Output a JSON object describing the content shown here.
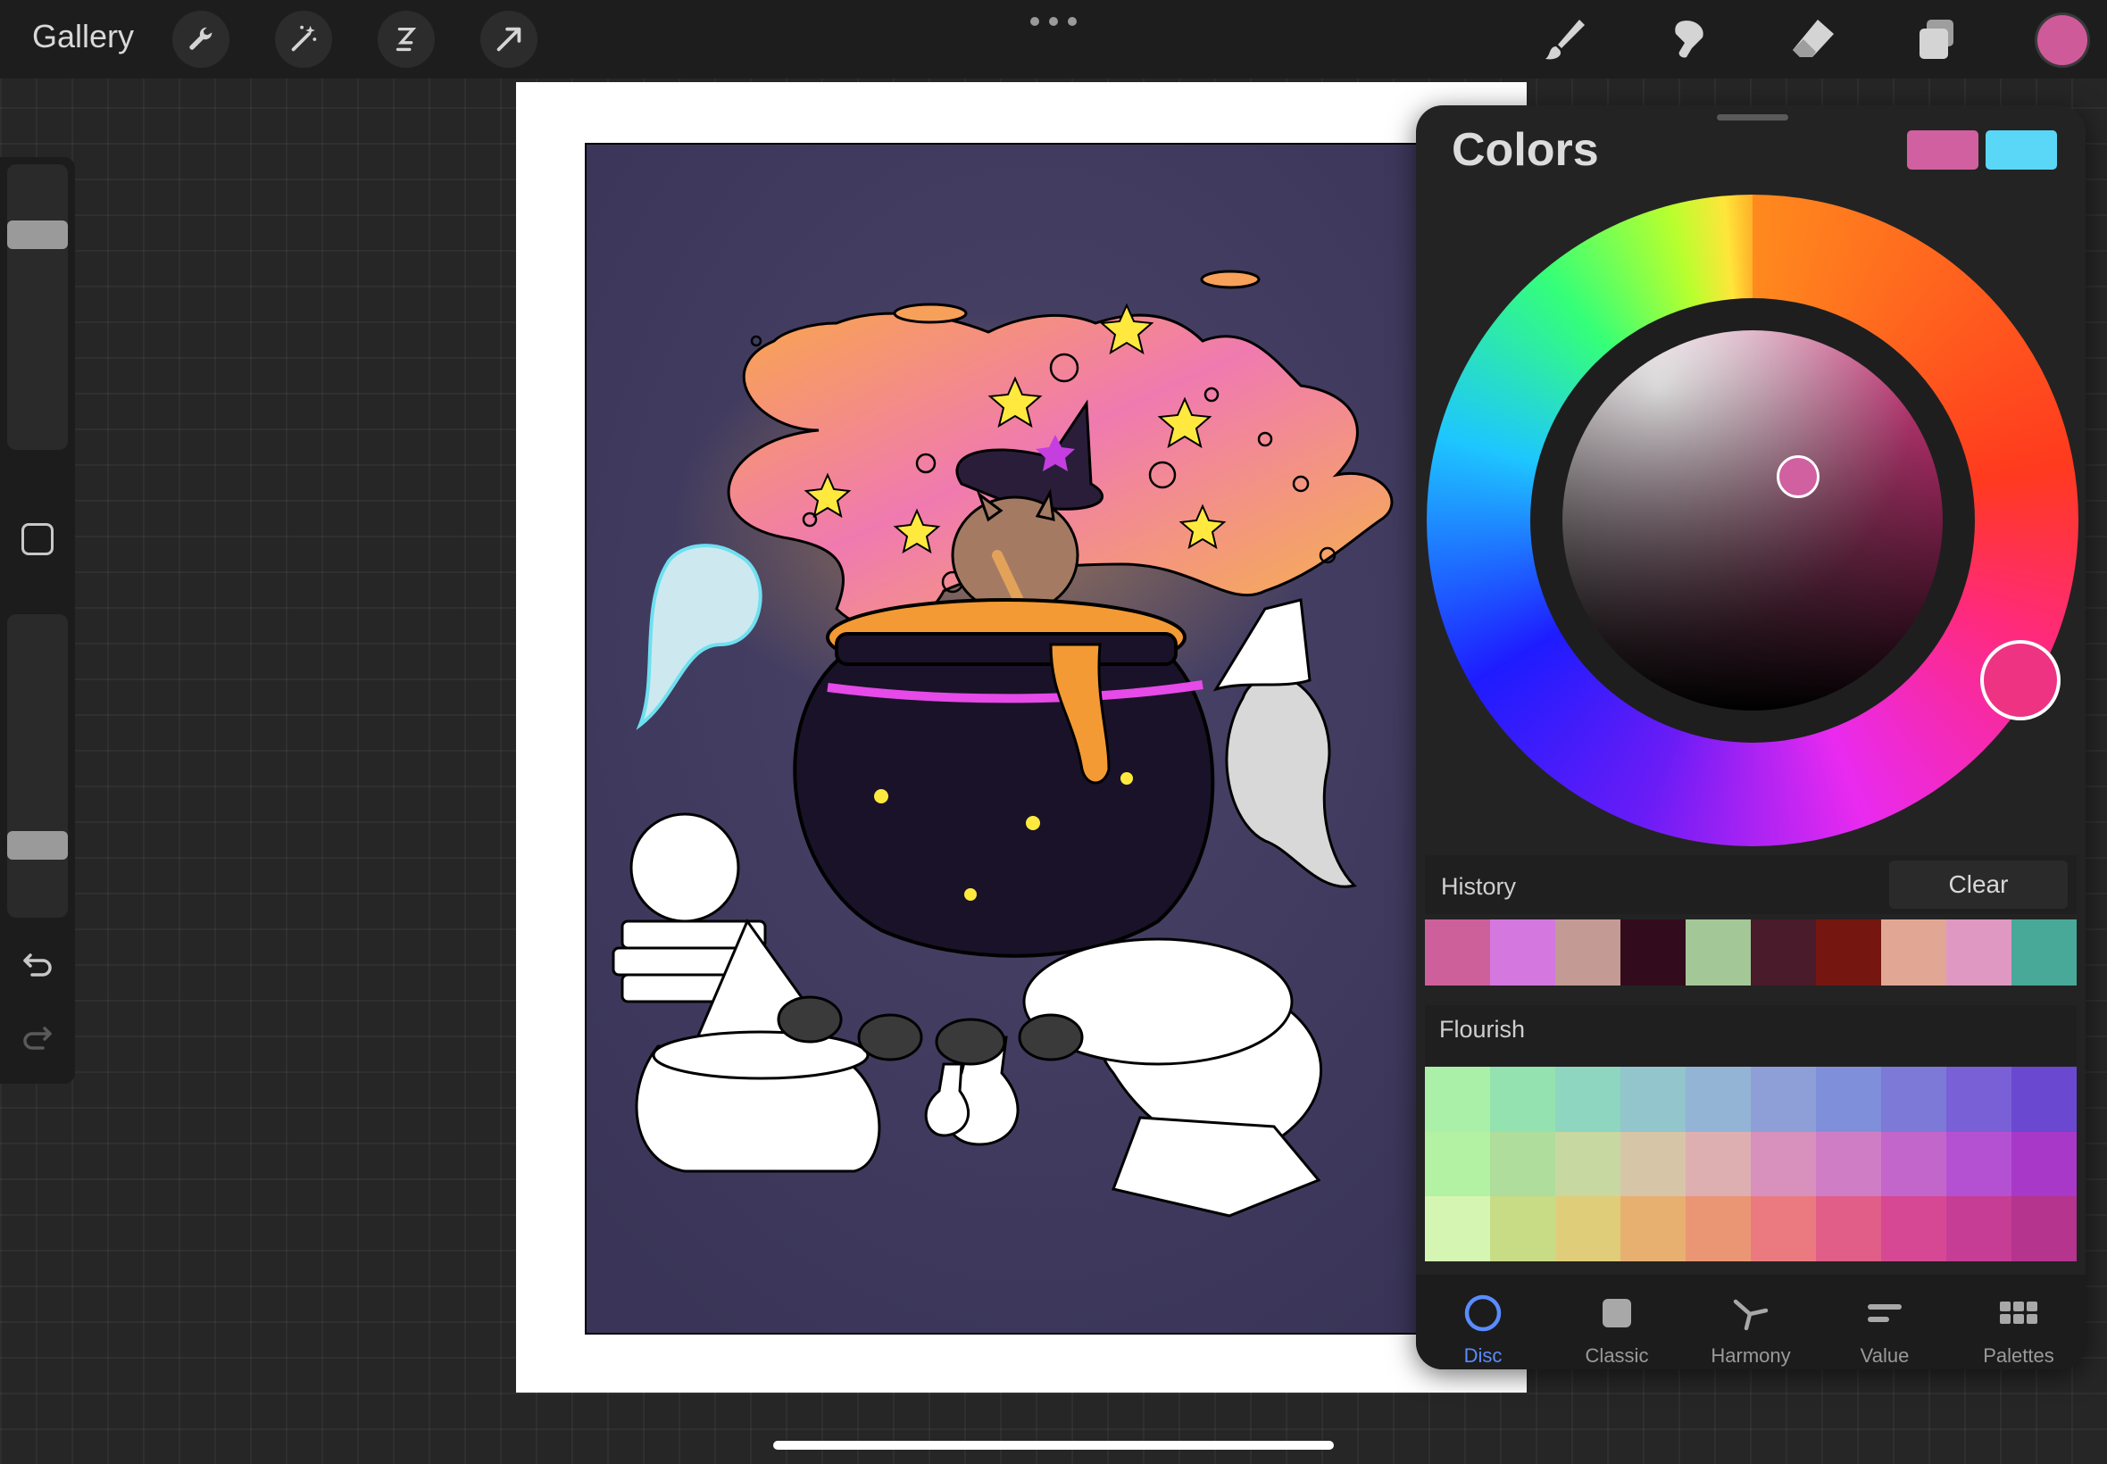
{
  "topbar": {
    "gallery_label": "Gallery",
    "tools": [
      "wrench-icon",
      "magic-wand-icon",
      "selection-icon",
      "transform-icon"
    ],
    "right_tools": [
      "brush-icon",
      "smudge-icon",
      "eraser-icon",
      "layers-icon"
    ],
    "current_color": "#cf5a9a"
  },
  "sidebar": {
    "size_slider_level": 0.78,
    "opacity_slider_level": 0.21,
    "icons": [
      "modify-square-icon",
      "undo-icon",
      "redo-icon"
    ]
  },
  "colors_panel": {
    "title": "Colors",
    "primary_color": "#d0609f",
    "secondary_color": "#5ad6f6",
    "history": {
      "label": "History",
      "clear_label": "Clear",
      "swatches": [
        "#cd5f9b",
        "#d477df",
        "#c49a95",
        "#320c1c",
        "#a4c797",
        "#4a1b2b",
        "#751610",
        "#e2a695",
        "#df98c1",
        "#48a999"
      ]
    },
    "flourish": {
      "label": "Flourish",
      "swatches": [
        "#aaf0a9",
        "#94e2af",
        "#8ed6c0",
        "#92c5cc",
        "#93b4d5",
        "#8e9fd7",
        "#7f8fda",
        "#7d79d6",
        "#7960d7",
        "#6b48d0",
        "#b3f2a2",
        "#aedd9c",
        "#c8d8a1",
        "#d7c5a8",
        "#deafb1",
        "#d891bc",
        "#cf7ec6",
        "#c266cc",
        "#b451d2",
        "#a838c8",
        "#d5f6b3",
        "#c7dc85",
        "#e0cd7a",
        "#e8b070",
        "#ea9674",
        "#ea7a7f",
        "#e05e88",
        "#d64893",
        "#c63d95",
        "#b4348e"
      ]
    },
    "tabs": [
      {
        "label": "Disc",
        "icon": "disc-icon",
        "active": true
      },
      {
        "label": "Classic",
        "icon": "classic-square-icon",
        "active": false
      },
      {
        "label": "Harmony",
        "icon": "harmony-icon",
        "active": false
      },
      {
        "label": "Value",
        "icon": "value-sliders-icon",
        "active": false
      },
      {
        "label": "Palettes",
        "icon": "palettes-grid-icon",
        "active": false
      }
    ]
  }
}
